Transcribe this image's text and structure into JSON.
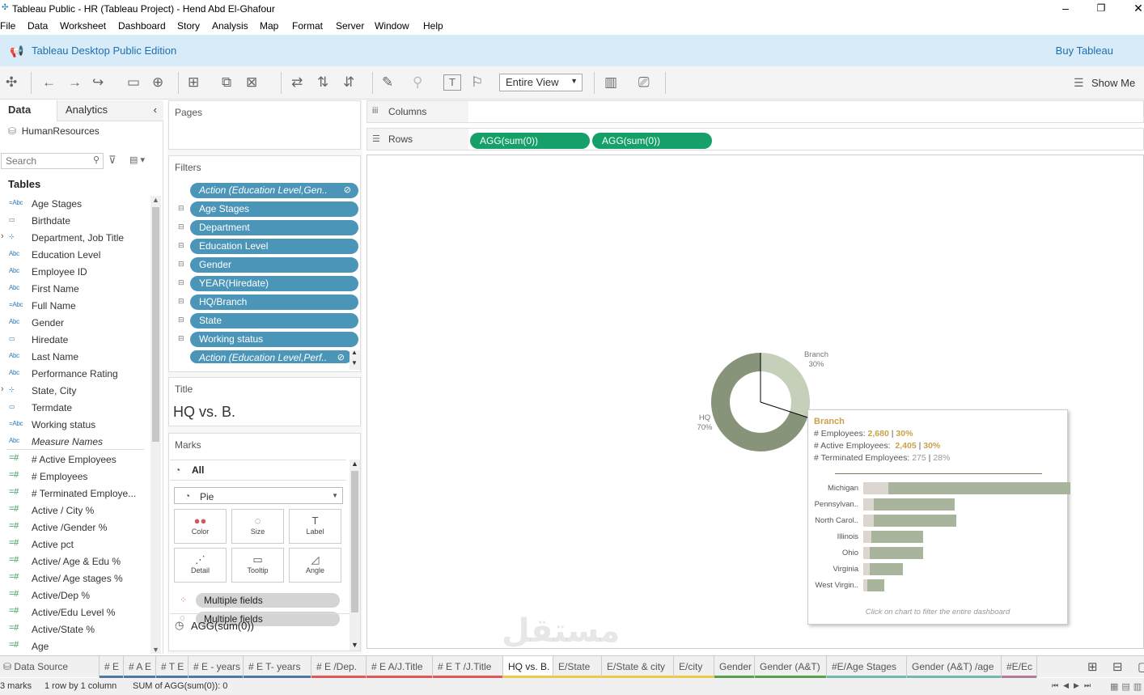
{
  "window": {
    "title": "Tableau Public - HR (Tableau Project) - Hend Abd El-Ghafour"
  },
  "menu": [
    "File",
    "Data",
    "Worksheet",
    "Dashboard",
    "Story",
    "Analysis",
    "Map",
    "Format",
    "Server",
    "Window",
    "Help"
  ],
  "banner": {
    "edition": "Tableau Desktop Public Edition",
    "buy": "Buy Tableau"
  },
  "toolbar": {
    "fit": "Entire View",
    "show_me": "Show Me"
  },
  "left": {
    "tab_data": "Data",
    "tab_analytics": "Analytics",
    "source": "HumanResources",
    "search_placeholder": "Search",
    "tables_heading": "Tables",
    "fields": [
      {
        "type": "=Abc",
        "label": "Age Stages"
      },
      {
        "type": "cal",
        "label": "Birthdate"
      },
      {
        "type": "hier",
        "label": "Department, Job Title",
        "exp": true
      },
      {
        "type": "Abc",
        "label": "Education Level"
      },
      {
        "type": "Abc",
        "label": "Employee ID"
      },
      {
        "type": "Abc",
        "label": "First Name"
      },
      {
        "type": "=Abc",
        "label": "Full Name"
      },
      {
        "type": "Abc",
        "label": "Gender"
      },
      {
        "type": "cal",
        "label": "Hiredate"
      },
      {
        "type": "Abc",
        "label": "Last Name"
      },
      {
        "type": "Abc",
        "label": "Performance Rating"
      },
      {
        "type": "hier",
        "label": "State, City",
        "exp": true
      },
      {
        "type": "cal",
        "label": "Termdate"
      },
      {
        "type": "=Abc",
        "label": "Working status"
      },
      {
        "type": "Abc",
        "label": "Measure Names",
        "italic": true
      }
    ],
    "measures": [
      "# Active Employees",
      "# Employees",
      "# Terminated Employe...",
      "Active / City %",
      "Active /Gender %",
      "Active pct",
      "Active/ Age & Edu %",
      "Active/ Age stages %",
      "Active/Dep %",
      "Active/Edu Level %",
      "Active/State %",
      "Age"
    ]
  },
  "shelves": {
    "pages": "Pages",
    "filters_heading": "Filters",
    "filters": [
      {
        "label": "Action (Education Level,Gen..",
        "italic": true,
        "link": true
      },
      {
        "label": "Age Stages"
      },
      {
        "label": "Department"
      },
      {
        "label": "Education Level"
      },
      {
        "label": "Gender"
      },
      {
        "label": "YEAR(Hiredate)"
      },
      {
        "label": "HQ/Branch"
      },
      {
        "label": "State"
      },
      {
        "label": "Working status"
      },
      {
        "label": "Action (Education Level,Perf..",
        "italic": true,
        "link": true
      }
    ],
    "title_heading": "Title",
    "title_value": "HQ vs. B.",
    "marks_heading": "Marks",
    "marks_all": "All",
    "mark_type": "Pie",
    "mark_buttons": [
      {
        "icon": "●●",
        "label": "Color"
      },
      {
        "icon": "◌",
        "label": "Size"
      },
      {
        "icon": "T",
        "label": "Label"
      },
      {
        "icon": "⋰",
        "label": "Detail"
      },
      {
        "icon": "▭",
        "label": "Tooltip"
      },
      {
        "icon": "◿",
        "label": "Angle"
      }
    ],
    "mark_pills": [
      "Multiple fields",
      "Multiple fields"
    ],
    "agg": "AGG(sum(0))"
  },
  "columns_label": "Columns",
  "rows_label": "Rows",
  "rows_pills": [
    "AGG(sum(0))",
    "AGG(sum(0))"
  ],
  "chart_data": {
    "type": "pie",
    "slices": [
      {
        "label": "HQ",
        "pct": "70%",
        "value": 70
      },
      {
        "label": "Branch",
        "pct": "30%",
        "value": 30
      }
    ],
    "colors": {
      "HQ": "#879479",
      "Branch": "#c6cfba"
    }
  },
  "tooltip": {
    "title": "Branch",
    "lines": [
      {
        "label": "# Employees:",
        "value": "2,680",
        "pct": "30%"
      },
      {
        "label": "# Active Employees:",
        "value": "2,405",
        "pct": "30%"
      },
      {
        "label": "# Terminated Employees:",
        "value": "275",
        "pct": "28%",
        "muted": true
      }
    ],
    "bars": [
      {
        "label": "Michigan",
        "a": 0.88,
        "b": 0.12
      },
      {
        "label": "Pennsylvan..",
        "a": 0.39,
        "b": 0.05
      },
      {
        "label": "North Carol..",
        "a": 0.4,
        "b": 0.05
      },
      {
        "label": "Illinois",
        "a": 0.25,
        "b": 0.04
      },
      {
        "label": "Ohio",
        "a": 0.26,
        "b": 0.03
      },
      {
        "label": "Virginia",
        "a": 0.16,
        "b": 0.03
      },
      {
        "label": "West Virgin..",
        "a": 0.08,
        "b": 0.02
      }
    ],
    "footer": "Click on chart to filter the entire dashboard"
  },
  "sheet_tabs": [
    {
      "label": "Data Source",
      "color": ""
    },
    {
      "label": "# E",
      "color": "#4e79a7"
    },
    {
      "label": "# A E",
      "color": "#4e79a7"
    },
    {
      "label": "# T E",
      "color": "#4e79a7"
    },
    {
      "label": "# E - years",
      "color": "#4e79a7"
    },
    {
      "label": "# E T- years",
      "color": "#4e79a7"
    },
    {
      "label": "# E /Dep.",
      "color": "#e15759"
    },
    {
      "label": "# E A/J.Title",
      "color": "#e15759"
    },
    {
      "label": "# E T /J.Title",
      "color": "#e15759"
    },
    {
      "label": "HQ vs. B.",
      "color": "#edc948",
      "active": true
    },
    {
      "label": "E/State",
      "color": "#edc948"
    },
    {
      "label": "E/State & city",
      "color": "#edc948"
    },
    {
      "label": "E/city",
      "color": "#edc948"
    },
    {
      "label": "Gender",
      "color": "#59a14f"
    },
    {
      "label": "Gender (A&T)",
      "color": "#59a14f"
    },
    {
      "label": "#E/Age Stages",
      "color": "#76b7b2"
    },
    {
      "label": "Gender (A&T) /age",
      "color": "#76b7b2"
    },
    {
      "label": "#E/Ec",
      "color": "#b07aa1"
    }
  ],
  "status": {
    "marks": "3 marks",
    "rows": "1 row by 1 column",
    "sum": "SUM of AGG(sum(0)): 0"
  },
  "watermark": "مستقل"
}
